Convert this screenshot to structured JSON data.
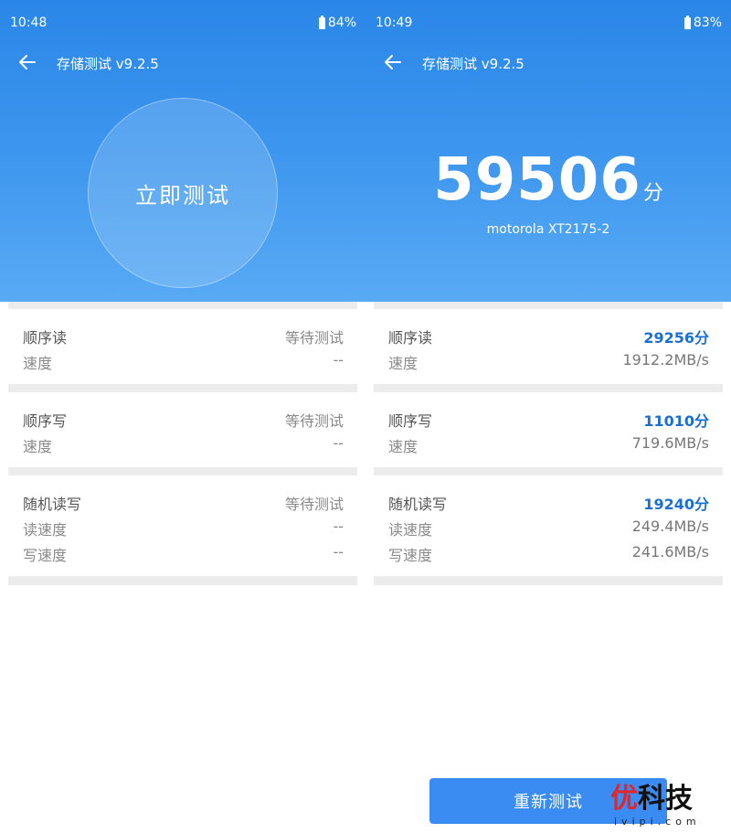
{
  "left": {
    "status": {
      "time": "10:48",
      "battery": "84%"
    },
    "title": "存储测试 v9.2.5",
    "start_button": "立即测试",
    "sections": [
      {
        "name": "顺序读",
        "status": "等待测试",
        "rows": [
          {
            "label": "速度",
            "value": "--"
          }
        ]
      },
      {
        "name": "顺序写",
        "status": "等待测试",
        "rows": [
          {
            "label": "速度",
            "value": "--"
          }
        ]
      },
      {
        "name": "随机读写",
        "status": "等待测试",
        "rows": [
          {
            "label": "读速度",
            "value": "--"
          },
          {
            "label": "写速度",
            "value": "--"
          }
        ]
      }
    ]
  },
  "right": {
    "status": {
      "time": "10:49",
      "battery": "83%"
    },
    "title": "存储测试 v9.2.5",
    "score": "59506",
    "score_unit": "分",
    "device": "motorola XT2175-2",
    "sections": [
      {
        "name": "顺序读",
        "score": "29256分",
        "rows": [
          {
            "label": "速度",
            "value": "1912.2MB/s"
          }
        ]
      },
      {
        "name": "顺序写",
        "score": "11010分",
        "rows": [
          {
            "label": "速度",
            "value": "719.6MB/s"
          }
        ]
      },
      {
        "name": "随机读写",
        "score": "19240分",
        "rows": [
          {
            "label": "读速度",
            "value": "249.4MB/s"
          },
          {
            "label": "写速度",
            "value": "241.6MB/s"
          }
        ]
      }
    ],
    "retest_button": "重新测试"
  },
  "watermark": {
    "brand": "优科技",
    "brand_red": "优",
    "brand_rest": "科技",
    "url": "ivipi.com"
  },
  "colors": {
    "header_top": "#2a86e8",
    "header_bottom": "#58aaf4",
    "score_blue": "#1a6fd4",
    "button_blue": "#3b8cf2"
  }
}
